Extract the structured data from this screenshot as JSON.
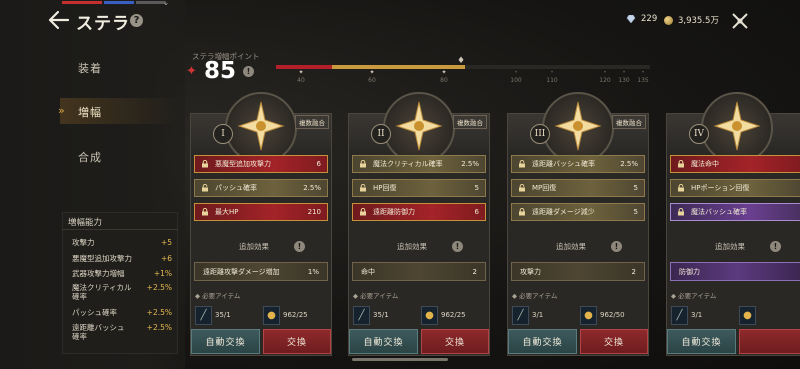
{
  "header": {
    "title": "ステラ",
    "gems": "229",
    "gold": "3,935.5万"
  },
  "nav": {
    "items": [
      {
        "label": "装着"
      },
      {
        "label": "増幅"
      },
      {
        "label": "合成"
      }
    ],
    "active": "増幅"
  },
  "stat_panel": {
    "title": "増幅能力",
    "rows": [
      {
        "name": "攻撃力",
        "value": "+5"
      },
      {
        "name": "悪魔型追加攻撃力",
        "value": "+6"
      },
      {
        "name": "武器攻撃力増幅",
        "value": "+1%"
      },
      {
        "name": "魔法クリティカル",
        "name2": "確率",
        "value": "+2.5%"
      },
      {
        "name": "パッシュ確率",
        "value": "+2.5%"
      },
      {
        "name": "遠距離バッシュ",
        "name2": "確率",
        "value": "+2.5%"
      }
    ]
  },
  "points": {
    "label": "ステラ増幅ポイント",
    "value": "85",
    "fill_fraction": 0.5,
    "milestones": [
      "40",
      "60",
      "80",
      "100",
      "110",
      "120",
      "130",
      "135"
    ]
  },
  "cards": [
    {
      "roman": "I",
      "tag": "複数融合",
      "slots": [
        {
          "name": "悪魔型追加攻撃力",
          "value": "6",
          "style": "red",
          "locked": true
        },
        {
          "name": "パッシュ確率",
          "value": "2.5%",
          "style": "gold",
          "locked": false
        },
        {
          "name": "最大HP",
          "value": "210",
          "style": "red",
          "locked": true
        }
      ],
      "addl_label": "追加効果",
      "addl": {
        "name": "遠距離攻撃ダメージ増加",
        "value": "1%",
        "style": "gold"
      },
      "req_label": "必要アイテム",
      "req": [
        {
          "value": "35/1"
        },
        {
          "value": "962/25"
        }
      ],
      "auto_label": "自動交換",
      "exchange_label": "交換"
    },
    {
      "roman": "II",
      "tag": "複数融合",
      "slots": [
        {
          "name": "魔法クリティカル確率",
          "value": "2.5%",
          "style": "gold",
          "locked": true
        },
        {
          "name": "HP回復",
          "value": "5",
          "style": "gold",
          "locked": false
        },
        {
          "name": "遠距離防御力",
          "value": "6",
          "style": "red",
          "locked": true
        }
      ],
      "addl_label": "追加効果",
      "addl": {
        "name": "命中",
        "value": "2",
        "style": "gold"
      },
      "req_label": "必要アイテム",
      "req": [
        {
          "value": "35/1"
        },
        {
          "value": "962/25"
        }
      ],
      "auto_label": "自動交換",
      "exchange_label": "交換"
    },
    {
      "roman": "III",
      "tag": "複数融合",
      "slots": [
        {
          "name": "遠距離バッシュ確率",
          "value": "2.5%",
          "style": "gold",
          "locked": false
        },
        {
          "name": "MP回復",
          "value": "5",
          "style": "gold",
          "locked": false
        },
        {
          "name": "遠距離ダメージ減少",
          "value": "5",
          "style": "gold",
          "locked": true
        }
      ],
      "addl_label": "追加効果",
      "addl": {
        "name": "攻撃力",
        "value": "2",
        "style": "gold"
      },
      "req_label": "必要アイテム",
      "req": [
        {
          "value": "3/1"
        },
        {
          "value": "962/50"
        }
      ],
      "auto_label": "自動交換",
      "exchange_label": "交換"
    },
    {
      "roman": "IV",
      "tag": "",
      "slots": [
        {
          "name": "魔法命中",
          "value": "",
          "style": "red",
          "locked": true
        },
        {
          "name": "HPポーション回復",
          "value": "",
          "style": "gold",
          "locked": false
        },
        {
          "name": "魔法バッシュ確率",
          "value": "",
          "style": "purple",
          "locked": true
        }
      ],
      "addl_label": "追加効果",
      "addl": {
        "name": "防御力",
        "value": "",
        "style": "purple"
      },
      "req_label": "必要アイテム",
      "req": [
        {
          "value": "3/1"
        },
        {
          "value": ""
        }
      ],
      "auto_label": "自動交換",
      "exchange_label": ""
    }
  ]
}
